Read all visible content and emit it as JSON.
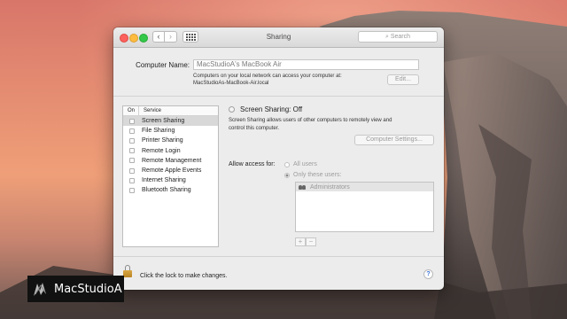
{
  "window": {
    "title": "Sharing",
    "search_placeholder": "Search",
    "nav": {
      "back": "‹",
      "forward": "›"
    }
  },
  "computer": {
    "name_label": "Computer Name:",
    "name_value": "MacStudioA's MacBook Air",
    "access_note_line1": "Computers on your local network can access your computer at:",
    "access_note_line2": "MacStudioAs-MacBook-Air.local",
    "edit_button": "Edit..."
  },
  "services": {
    "header_on": "On",
    "header_service": "Service",
    "items": [
      {
        "label": "Screen Sharing",
        "checked": false,
        "selected": true
      },
      {
        "label": "File Sharing",
        "checked": false,
        "selected": false
      },
      {
        "label": "Printer Sharing",
        "checked": false,
        "selected": false
      },
      {
        "label": "Remote Login",
        "checked": false,
        "selected": false
      },
      {
        "label": "Remote Management",
        "checked": false,
        "selected": false
      },
      {
        "label": "Remote Apple Events",
        "checked": false,
        "selected": false
      },
      {
        "label": "Internet Sharing",
        "checked": false,
        "selected": false
      },
      {
        "label": "Bluetooth Sharing",
        "checked": false,
        "selected": false
      }
    ]
  },
  "detail": {
    "status": "Screen Sharing: Off",
    "description_line1": "Screen Sharing allows users of other computers to remotely view and",
    "description_line2": "control this computer.",
    "settings_button": "Computer Settings...",
    "allow_label": "Allow access for:",
    "option_all": "All users",
    "option_only": "Only these users:",
    "selected_option": "only",
    "users": [
      "Administrators"
    ],
    "add": "+",
    "remove": "−"
  },
  "footer": {
    "lock_text": "Click the lock to make changes.",
    "help": "?"
  },
  "watermark": {
    "text": "MacStudioA"
  },
  "colors": {
    "close": "#fc605c",
    "minimize": "#fdbc40",
    "zoom": "#34c84a",
    "help_blue": "#3a73d8"
  }
}
